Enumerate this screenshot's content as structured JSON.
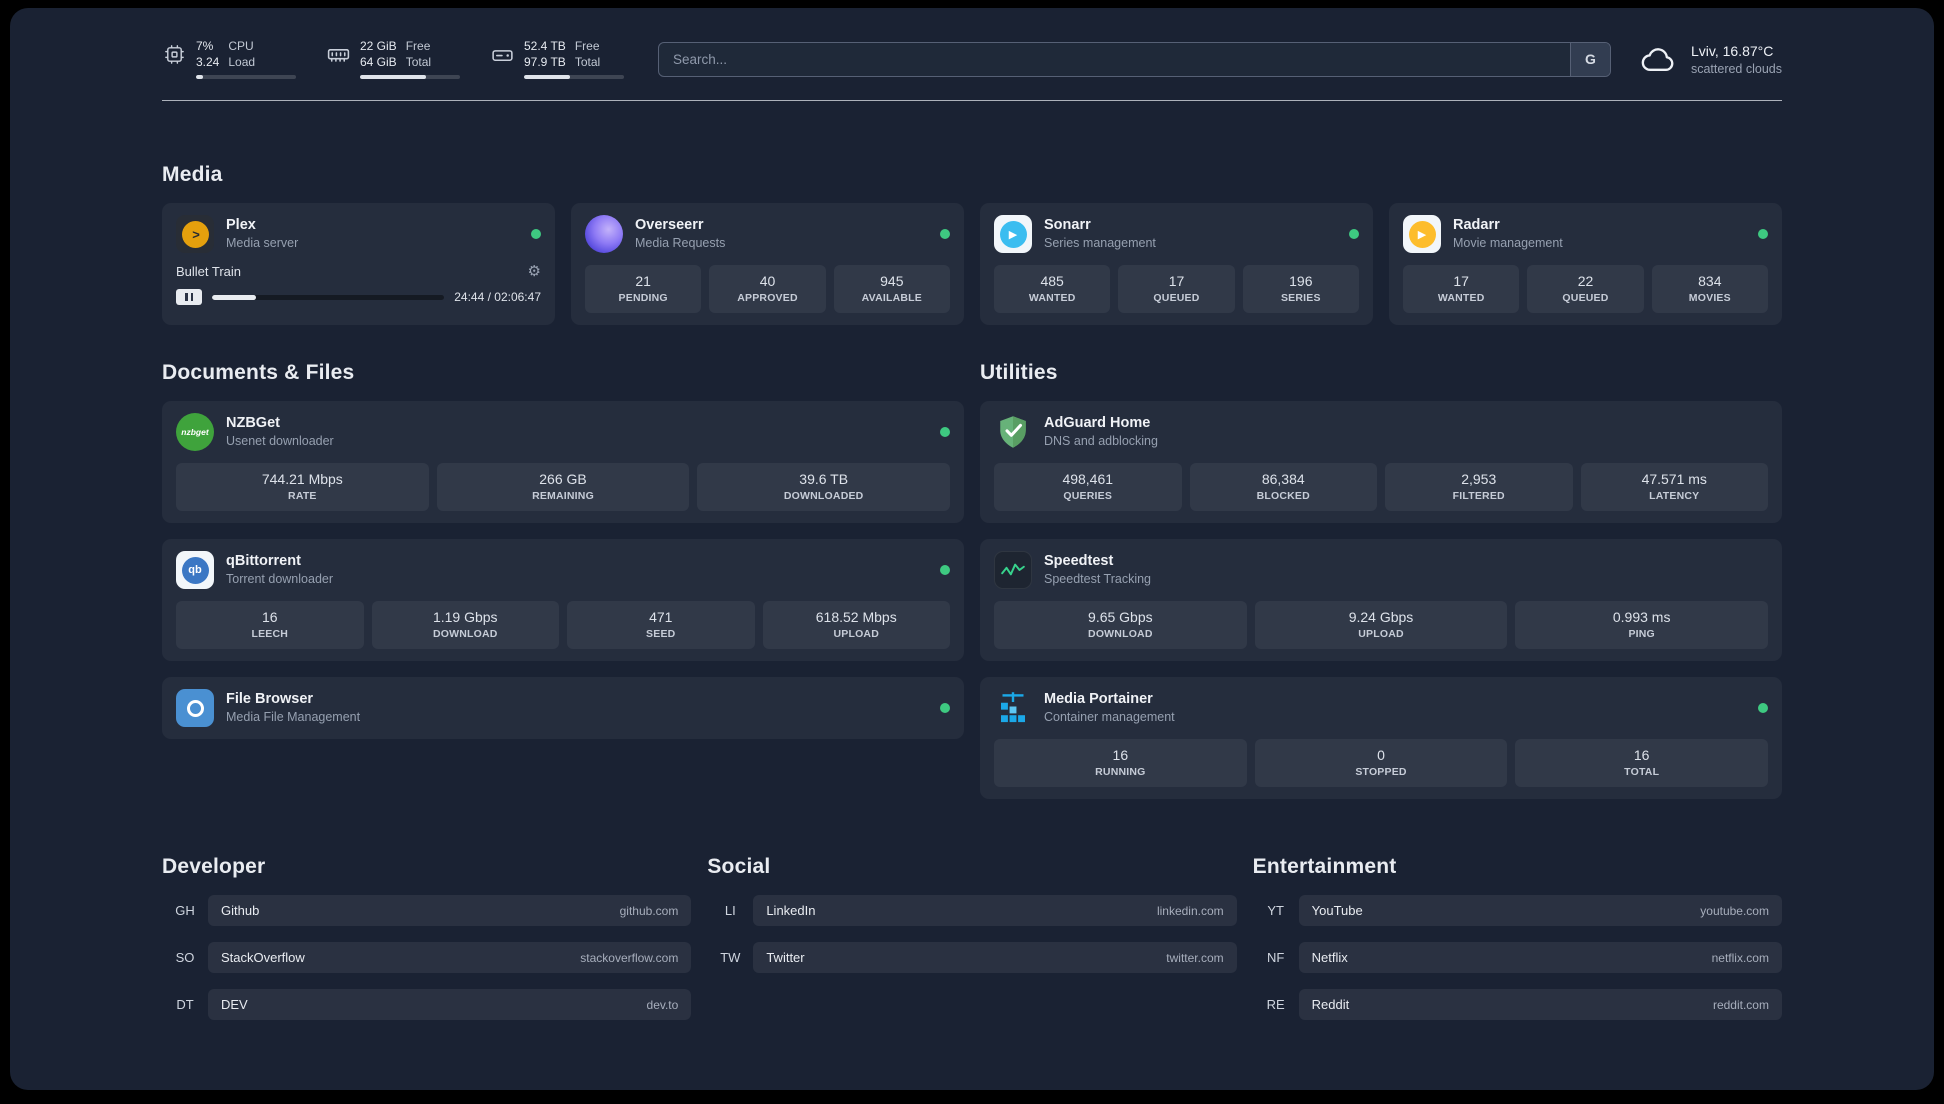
{
  "colors": {
    "background": "#1a2233",
    "status_online": "#3ec981",
    "plex_amber": "#e5a00d",
    "sonarr_blue": "#3bbdf0",
    "radarr_amber": "#fdbd2c",
    "nzbget_green": "#3fa33c",
    "qbittorrent_blue": "#3b77c4",
    "filebrowser_blue": "#4a90d2",
    "adguard_green": "#67b279",
    "speedtest_green": "#37d38d",
    "portainer_blue": "#1ba8e8"
  },
  "topbar": {
    "cpu": {
      "value_top": "7%",
      "value_bottom": "3.24",
      "label_top": "CPU",
      "label_bottom": "Load",
      "bar_percent": 7
    },
    "ram": {
      "value_top": "22 GiB",
      "value_bottom": "64 GiB",
      "label_top": "Free",
      "label_bottom": "Total",
      "bar_percent": 66
    },
    "disk": {
      "value_top": "52.4 TB",
      "value_bottom": "97.9 TB",
      "label_top": "Free",
      "label_bottom": "Total",
      "bar_percent": 46
    },
    "search": {
      "placeholder": "Search...",
      "provider_label": "G"
    },
    "weather": {
      "location": "Lviv, 16.87°C",
      "condition": "scattered clouds"
    }
  },
  "sections": {
    "media": "Media",
    "documents": "Documents & Files",
    "utilities": "Utilities",
    "developer": "Developer",
    "social": "Social",
    "entertainment": "Entertainment"
  },
  "services": {
    "plex": {
      "name": "Plex",
      "subtitle": "Media server",
      "player": {
        "track": "Bullet Train",
        "time": "24:44 / 02:06:47",
        "progress_percent": 19
      }
    },
    "overseerr": {
      "name": "Overseerr",
      "subtitle": "Media Requests",
      "stats": [
        {
          "value": "21",
          "label": "PENDING"
        },
        {
          "value": "40",
          "label": "APPROVED"
        },
        {
          "value": "945",
          "label": "AVAILABLE"
        }
      ]
    },
    "sonarr": {
      "name": "Sonarr",
      "subtitle": "Series management",
      "stats": [
        {
          "value": "485",
          "label": "WANTED"
        },
        {
          "value": "17",
          "label": "QUEUED"
        },
        {
          "value": "196",
          "label": "SERIES"
        }
      ]
    },
    "radarr": {
      "name": "Radarr",
      "subtitle": "Movie management",
      "stats": [
        {
          "value": "17",
          "label": "WANTED"
        },
        {
          "value": "22",
          "label": "QUEUED"
        },
        {
          "value": "834",
          "label": "MOVIES"
        }
      ]
    },
    "nzbget": {
      "name": "NZBGet",
      "subtitle": "Usenet downloader",
      "stats": [
        {
          "value": "744.21 Mbps",
          "label": "RATE"
        },
        {
          "value": "266 GB",
          "label": "REMAINING"
        },
        {
          "value": "39.6 TB",
          "label": "DOWNLOADED"
        }
      ]
    },
    "qbittorrent": {
      "name": "qBittorrent",
      "subtitle": "Torrent downloader",
      "stats": [
        {
          "value": "16",
          "label": "LEECH"
        },
        {
          "value": "1.19 Gbps",
          "label": "DOWNLOAD"
        },
        {
          "value": "471",
          "label": "SEED"
        },
        {
          "value": "618.52 Mbps",
          "label": "UPLOAD"
        }
      ]
    },
    "filebrowser": {
      "name": "File Browser",
      "subtitle": "Media File Management"
    },
    "adguard": {
      "name": "AdGuard Home",
      "subtitle": "DNS and adblocking",
      "stats": [
        {
          "value": "498,461",
          "label": "QUERIES"
        },
        {
          "value": "86,384",
          "label": "BLOCKED"
        },
        {
          "value": "2,953",
          "label": "FILTERED"
        },
        {
          "value": "47.571 ms",
          "label": "LATENCY"
        }
      ]
    },
    "speedtest": {
      "name": "Speedtest",
      "subtitle": "Speedtest Tracking",
      "stats": [
        {
          "value": "9.65 Gbps",
          "label": "DOWNLOAD"
        },
        {
          "value": "9.24 Gbps",
          "label": "UPLOAD"
        },
        {
          "value": "0.993 ms",
          "label": "PING"
        }
      ]
    },
    "portainer": {
      "name": "Media Portainer",
      "subtitle": "Container management",
      "stats": [
        {
          "value": "16",
          "label": "RUNNING"
        },
        {
          "value": "0",
          "label": "STOPPED"
        },
        {
          "value": "16",
          "label": "TOTAL"
        }
      ]
    }
  },
  "bookmarks": {
    "developer": [
      {
        "abbr": "GH",
        "name": "Github",
        "domain": "github.com"
      },
      {
        "abbr": "SO",
        "name": "StackOverflow",
        "domain": "stackoverflow.com"
      },
      {
        "abbr": "DT",
        "name": "DEV",
        "domain": "dev.to"
      }
    ],
    "social": [
      {
        "abbr": "LI",
        "name": "LinkedIn",
        "domain": "linkedin.com"
      },
      {
        "abbr": "TW",
        "name": "Twitter",
        "domain": "twitter.com"
      }
    ],
    "entertainment": [
      {
        "abbr": "YT",
        "name": "YouTube",
        "domain": "youtube.com"
      },
      {
        "abbr": "NF",
        "name": "Netflix",
        "domain": "netflix.com"
      },
      {
        "abbr": "RE",
        "name": "Reddit",
        "domain": "reddit.com"
      }
    ]
  },
  "icons": {
    "plex_glyph": ">",
    "sonarr_glyph": "▶",
    "radarr_glyph": "▶",
    "nzbget_text": "nzbget",
    "qbittorrent_text": "qb",
    "gear_glyph": "⚙"
  }
}
